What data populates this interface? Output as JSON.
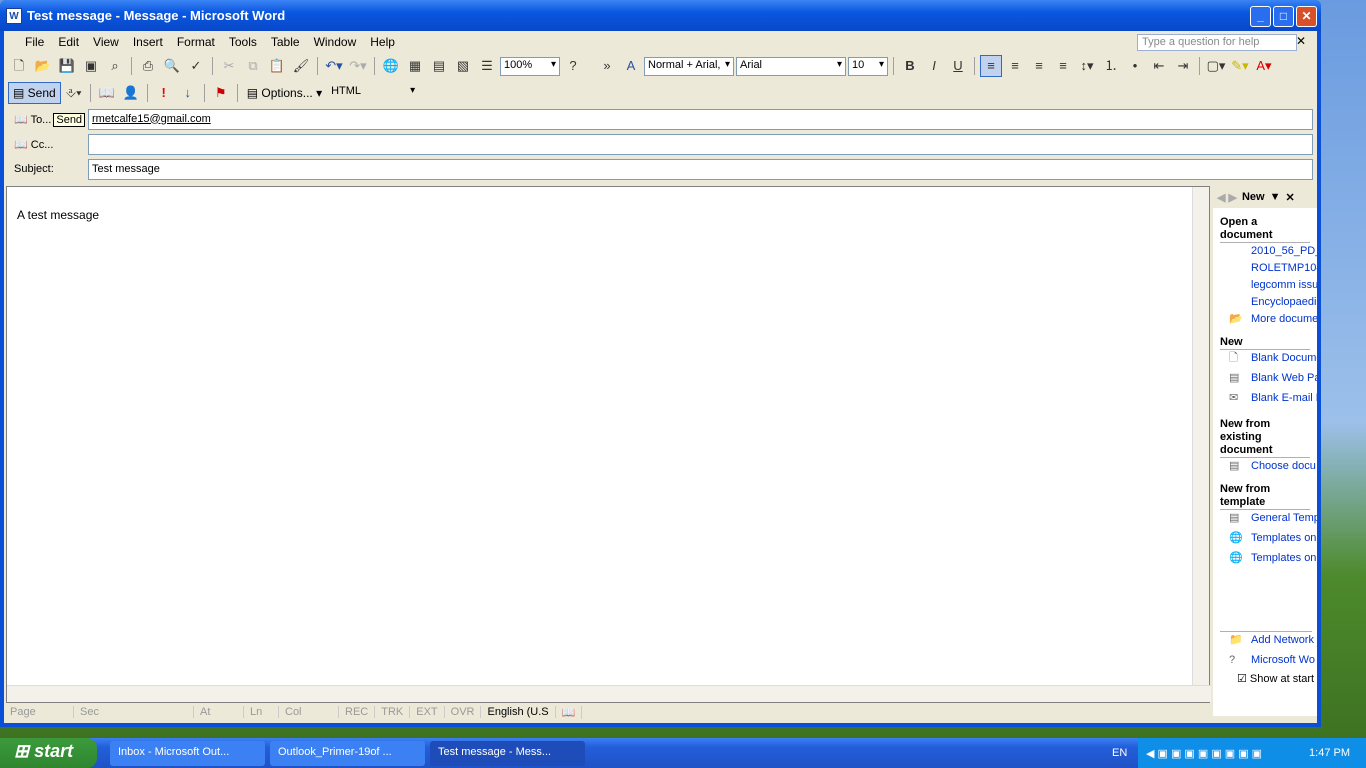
{
  "window": {
    "title": "Test message - Message - Microsoft Word",
    "app_icon": "W"
  },
  "menu": [
    "File",
    "Edit",
    "View",
    "Insert",
    "Format",
    "Tools",
    "Table",
    "Window",
    "Help"
  ],
  "help_placeholder": "Type a question for help",
  "toolbar": {
    "zoom": "100%",
    "style": "Normal + Arial,",
    "font": "Arial",
    "size": "10"
  },
  "mail_toolbar": {
    "send": "Send",
    "options": "Options...",
    "format": "HTML"
  },
  "fields": {
    "to_label": "To...",
    "to_tooltip": "Send",
    "to": "rmetcalfe15@gmail.com",
    "cc_label": "Cc...",
    "cc": "",
    "subject_label": "Subject:",
    "subject": "Test message"
  },
  "body": "A test message",
  "pane": {
    "title": "New",
    "open_heading": "Open a document",
    "recent": [
      "2010_56_PD_",
      "ROLETMP104",
      "legcomm issu",
      "Encyclopaedi"
    ],
    "more": "More docume",
    "new_heading": "New",
    "new_items": [
      "Blank Docume",
      "Blank Web Pa",
      "Blank E-mail M"
    ],
    "existing_heading": "New from existing document",
    "existing_item": "Choose docu",
    "template_heading": "New from template",
    "template_items": [
      "General Temp",
      "Templates on",
      "Templates on"
    ],
    "bottom": [
      "Add Network",
      "Microsoft Wo"
    ],
    "show_at_start": "Show at start"
  },
  "status": [
    "Page",
    "Sec",
    "At",
    "Ln",
    "Col",
    "REC",
    "TRK",
    "EXT",
    "OVR",
    "English (U.S"
  ],
  "taskbar": {
    "start": "start",
    "tasks": [
      "Inbox - Microsoft Out...",
      "Outlook_Primer-19of ...",
      "Test message - Mess..."
    ],
    "lang": "EN",
    "clock": "1:47 PM"
  }
}
